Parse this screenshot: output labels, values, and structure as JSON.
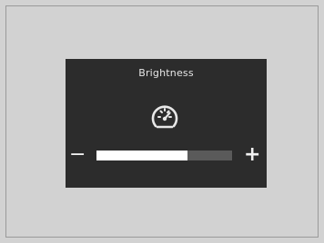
{
  "screen": {
    "title": "Brightness",
    "icon": "gauge-icon",
    "minus_label": "−",
    "plus_label": "+",
    "level": 0.67
  },
  "colors": {
    "panel_bg": "#2c2c2c",
    "fill": "#ffffff",
    "track": "#5a5a5a",
    "page_bg": "#d2d2d2"
  }
}
